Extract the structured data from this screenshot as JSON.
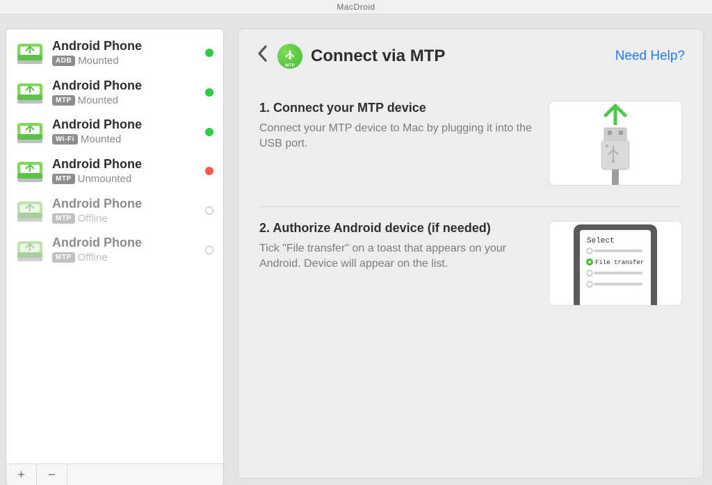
{
  "window": {
    "title": "MacDroid"
  },
  "sidebar": {
    "devices": [
      {
        "name": "Android Phone",
        "badge": "ADB",
        "state": "Mounted",
        "status": "green",
        "offline": false
      },
      {
        "name": "Android Phone",
        "badge": "MTP",
        "state": "Mounted",
        "status": "green",
        "offline": false
      },
      {
        "name": "Android Phone",
        "badge": "Wi-Fi",
        "state": "Mounted",
        "status": "green",
        "offline": false
      },
      {
        "name": "Android Phone",
        "badge": "MTP",
        "state": "Unmounted",
        "status": "red",
        "offline": false
      },
      {
        "name": "Android Phone",
        "badge": "MTP",
        "state": "Offline",
        "status": "hollow",
        "offline": true
      },
      {
        "name": "Android Phone",
        "badge": "MTP",
        "state": "Offline",
        "status": "hollow",
        "offline": true
      }
    ],
    "footer": {
      "add": "+",
      "remove": "−"
    }
  },
  "main": {
    "title": "Connect via MTP",
    "help": "Need Help?",
    "mtp_label": "MTP",
    "steps": [
      {
        "title": "1. Connect your MTP device",
        "desc": "Connect your MTP device to Mac by plugging it into the USB port."
      },
      {
        "title": "2. Authorize Android device (if needed)",
        "desc": "Tick \"File transfer\" on a toast that appears on your Android. Device will appear on the list."
      }
    ],
    "illus2": {
      "heading": "Select",
      "option": "File transfer"
    }
  }
}
